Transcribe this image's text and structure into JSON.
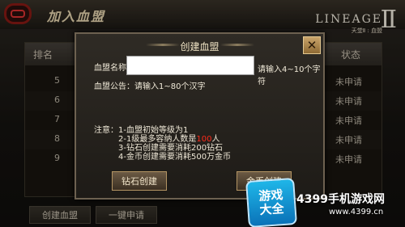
{
  "window": {
    "title": "加入血盟"
  },
  "logo": {
    "main": "LINEAGE",
    "mark": "Ⅱ",
    "sub": "天堂Ⅱ : 血盟"
  },
  "table": {
    "rank_header": "排名",
    "status_header": "状态",
    "rows": [
      {
        "rank": "5",
        "status": "未申请"
      },
      {
        "rank": "6",
        "status": "未申请"
      },
      {
        "rank": "7",
        "status": "未申请"
      },
      {
        "rank": "8",
        "status": "未申请"
      },
      {
        "rank": "9",
        "status": "未申请"
      }
    ]
  },
  "bottom_buttons": {
    "create": "创建血盟",
    "apply_all": "一键申请"
  },
  "dialog": {
    "title": "创建血盟",
    "name_label": "血盟名称",
    "name_value": "",
    "name_hint": "请输入4~10个字符",
    "notice_label": "血盟公告：请输入1~80个汉字",
    "notes_label": "注意：",
    "notes": {
      "line1": "1-血盟初始等级为1",
      "line2_prefix": "2-1级最多容纳人数是",
      "line2_num": "100",
      "line2_suffix": "人",
      "line3": "3-钻石创建需要消耗200钻石",
      "line4": "4-金币创建需要消耗500万金币"
    },
    "diamond_button": "钻石创建",
    "gold_button": "金币创建"
  },
  "watermark": {
    "badge_top": "游戏",
    "badge_bottom": "大全",
    "text": "4399手机游戏网",
    "url": "www.4399.cn"
  }
}
